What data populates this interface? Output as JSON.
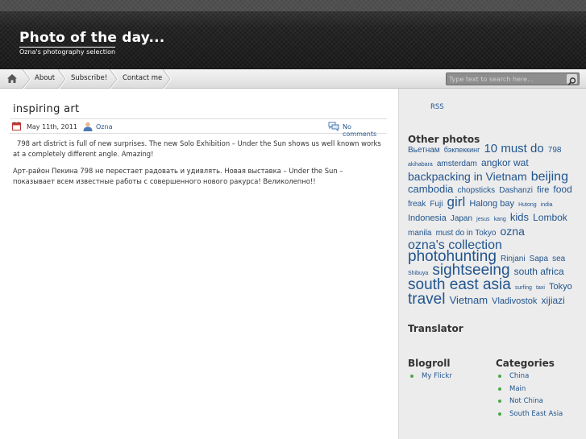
{
  "site": {
    "title": "Photo of the day...",
    "description": "Ozna's photography selection"
  },
  "nav": {
    "items": [
      "About",
      "Subscribe!",
      "Contact me"
    ]
  },
  "search": {
    "placeholder": "Type text to search here..."
  },
  "post": {
    "title": "inspiring art",
    "date": "May 11th, 2011",
    "author": "Ozna",
    "comments": "No comments",
    "paragraph_en": "798 art district is full of new surprises. The new Solo Exhibition – Under the Sun shows us well known works at a completely different angle. Amazing!",
    "paragraph_ru": "Арт-район Пекина 798 не перестает радовать и удивлять.  Новая выставка – Under the Sun – показывает всем известные работы с совершенного нового ракурса! Великолепно!!"
  },
  "sidebar": {
    "rss": "RSS",
    "other_photos_heading": "Other photos",
    "tags": [
      {
        "label": "Вьетнам",
        "size": 10
      },
      {
        "label": "бэкпеккинг",
        "size": 9
      },
      {
        "label": "10 must do",
        "size": 15
      },
      {
        "label": "798",
        "size": 10
      },
      {
        "label": "akihabara",
        "size": 7
      },
      {
        "label": "amsterdam",
        "size": 10
      },
      {
        "label": "angkor wat",
        "size": 12
      },
      {
        "label": "backpacking in Vietnam",
        "size": 14
      },
      {
        "label": "beijing",
        "size": 16
      },
      {
        "label": "cambodia",
        "size": 13
      },
      {
        "label": "chopsticks",
        "size": 10
      },
      {
        "label": "Dashanzi",
        "size": 10
      },
      {
        "label": "fire",
        "size": 11
      },
      {
        "label": "food",
        "size": 12
      },
      {
        "label": "freak",
        "size": 10
      },
      {
        "label": "Fuji",
        "size": 10
      },
      {
        "label": "girl",
        "size": 17
      },
      {
        "label": "Halong bay",
        "size": 11
      },
      {
        "label": "Hutong",
        "size": 7
      },
      {
        "label": "india",
        "size": 7
      },
      {
        "label": "Indonesia",
        "size": 11
      },
      {
        "label": "Japan",
        "size": 10
      },
      {
        "label": "jesus",
        "size": 7
      },
      {
        "label": "kang",
        "size": 7
      },
      {
        "label": "kids",
        "size": 13
      },
      {
        "label": "Lombok",
        "size": 12
      },
      {
        "label": "manila",
        "size": 10
      },
      {
        "label": "must do in Tokyo",
        "size": 10
      },
      {
        "label": "ozna",
        "size": 14
      },
      {
        "label": "ozna's collection",
        "size": 16
      },
      {
        "label": "photohunting",
        "size": 19
      },
      {
        "label": "Rinjani",
        "size": 10
      },
      {
        "label": "Sapa",
        "size": 10
      },
      {
        "label": "sea",
        "size": 10
      },
      {
        "label": "Shibuya",
        "size": 7
      },
      {
        "label": "sightseeing",
        "size": 19
      },
      {
        "label": "south africa",
        "size": 12
      },
      {
        "label": "south east asia",
        "size": 19
      },
      {
        "label": "surfing",
        "size": 7
      },
      {
        "label": "taxi",
        "size": 7
      },
      {
        "label": "Tokyo",
        "size": 11
      },
      {
        "label": "travel",
        "size": 19
      },
      {
        "label": "Vietnam",
        "size": 13
      },
      {
        "label": "Vladivostok",
        "size": 11
      },
      {
        "label": "xijiazi",
        "size": 12
      }
    ],
    "translator_heading": "Translator",
    "blogroll_heading": "Blogroll",
    "blogroll": [
      "My Flickr"
    ],
    "categories_heading": "Categories",
    "categories": [
      "China",
      "Main",
      "Not China",
      "South East Asia"
    ]
  },
  "colors": {
    "link": "#22558e",
    "bullet": "#4aa84a",
    "header_bg": "#1a1a1a",
    "sidebar_bg": "#ececec"
  }
}
